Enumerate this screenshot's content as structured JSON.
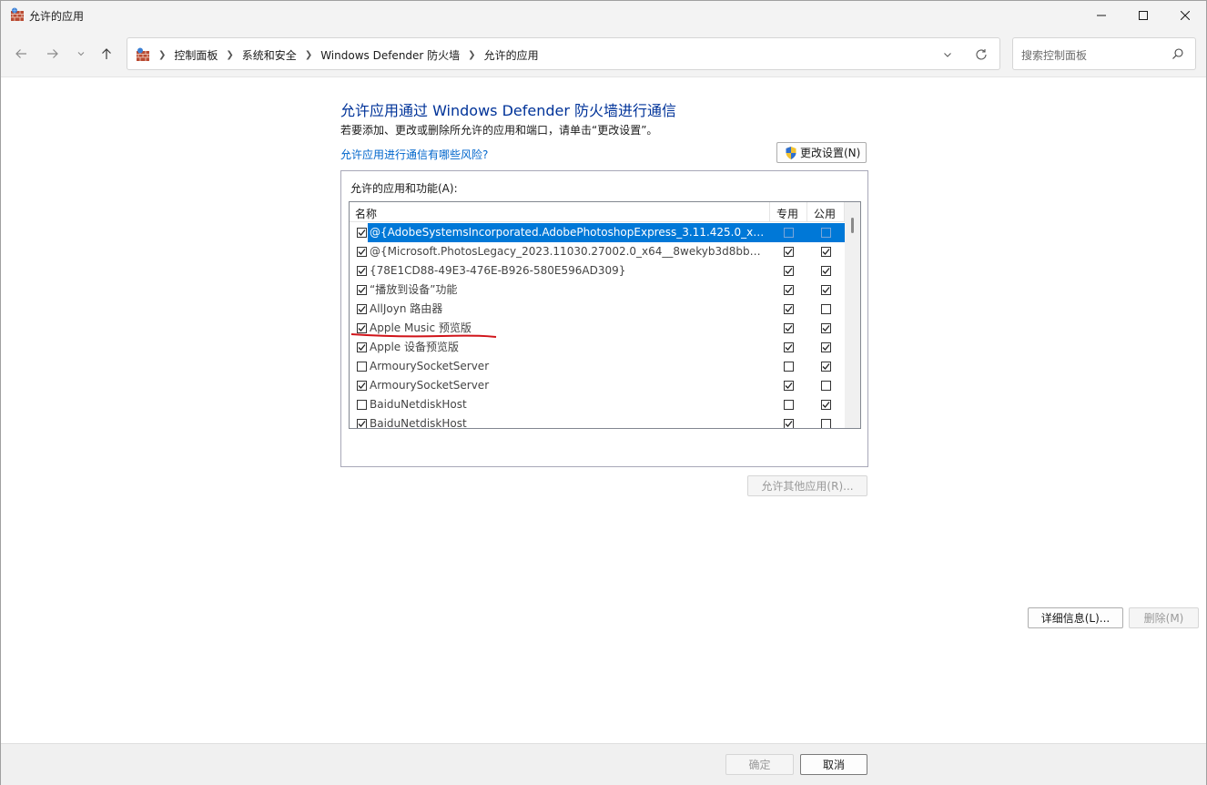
{
  "window": {
    "title": "允许的应用"
  },
  "address": {
    "crumbs": [
      "控制面板",
      "系统和安全",
      "Windows Defender 防火墙",
      "允许的应用"
    ]
  },
  "search": {
    "placeholder": "搜索控制面板"
  },
  "content": {
    "heading": "允许应用通过 Windows Defender 防火墙进行通信",
    "subtext": "若要添加、更改或删除所允许的应用和端口，请单击“更改设置”。",
    "risk_link": "允许应用进行通信有哪些风险?",
    "change_settings_label": "更改设置(N)"
  },
  "apps": {
    "group_label": "允许的应用和功能(A):",
    "columns": {
      "name": "名称",
      "private": "专用",
      "public": "公用"
    },
    "rows": [
      {
        "name": "@{AdobeSystemsIncorporated.AdobePhotoshopExpress_3.11.425.0_x64__...",
        "enabled": true,
        "private": false,
        "public": false,
        "selected": true
      },
      {
        "name": "@{Microsoft.PhotosLegacy_2023.11030.27002.0_x64__8wekyb3d8bbwe?m...",
        "enabled": true,
        "private": true,
        "public": true,
        "selected": false
      },
      {
        "name": "{78E1CD88-49E3-476E-B926-580E596AD309}",
        "enabled": true,
        "private": true,
        "public": true,
        "selected": false
      },
      {
        "name": "“播放到设备”功能",
        "enabled": true,
        "private": true,
        "public": true,
        "selected": false
      },
      {
        "name": "AllJoyn 路由器",
        "enabled": true,
        "private": true,
        "public": false,
        "selected": false
      },
      {
        "name": "Apple Music 预览版",
        "enabled": true,
        "private": true,
        "public": true,
        "selected": false
      },
      {
        "name": "Apple 设备预览版",
        "enabled": true,
        "private": true,
        "public": true,
        "selected": false
      },
      {
        "name": "ArmourySocketServer",
        "enabled": false,
        "private": false,
        "public": true,
        "selected": false
      },
      {
        "name": "ArmourySocketServer",
        "enabled": true,
        "private": true,
        "public": false,
        "selected": false
      },
      {
        "name": "BaiduNetdiskHost",
        "enabled": false,
        "private": false,
        "public": true,
        "selected": false
      },
      {
        "name": "BaiduNetdiskHost",
        "enabled": true,
        "private": true,
        "public": false,
        "selected": false
      }
    ],
    "details_label": "详细信息(L)...",
    "delete_label": "删除(M)"
  },
  "allow_other_label": "允许其他应用(R)...",
  "footer": {
    "ok_label": "确定",
    "cancel_label": "取消"
  },
  "colors": {
    "heading": "#003399",
    "link": "#0066cc",
    "selection": "#0078d7",
    "annotation_underline": "#d0141a"
  }
}
